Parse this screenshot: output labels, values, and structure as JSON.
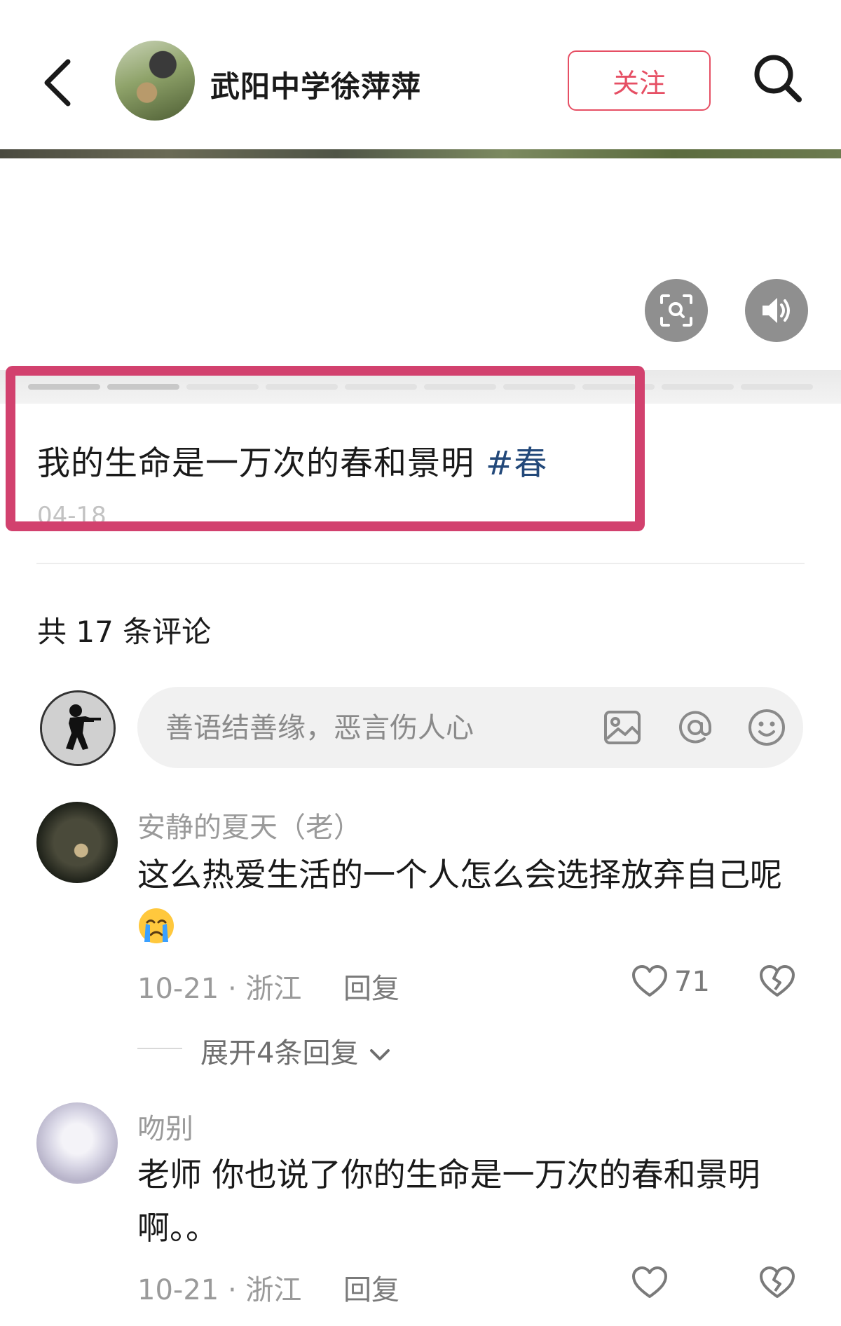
{
  "header": {
    "author_name": "武阳中学徐萍萍",
    "follow_label": "关注"
  },
  "post": {
    "caption": "我的生命是一万次的春和景明",
    "hashtag": "#春",
    "date": "04-18"
  },
  "comments_section": {
    "count_label": "共 17 条评论",
    "input_placeholder": "善语结善缘，恶言伤人心"
  },
  "comments": [
    {
      "user": "安静的夏天（老）",
      "text": "这么热爱生活的一个人怎么会选择放弃自己呢",
      "emoji": "crying-face-icon",
      "meta": "10-21 · 浙江",
      "reply_label": "回复",
      "likes": "71",
      "expand_label": "展开4条回复"
    },
    {
      "user": "吻别",
      "text": "老师 你也说了你的生命是一万次的春和景明啊。。",
      "meta": "10-21 · 浙江",
      "reply_label": "回复"
    }
  ],
  "icons": [
    "back-icon",
    "search-icon",
    "scan-icon",
    "speaker-icon",
    "image-icon",
    "at-icon",
    "emoji-icon",
    "heart-icon",
    "broken-heart-icon",
    "chevron-down-icon"
  ],
  "colors": {
    "accent": "#e64f64",
    "highlight": "#d2416e",
    "hashtag": "#23497a"
  }
}
